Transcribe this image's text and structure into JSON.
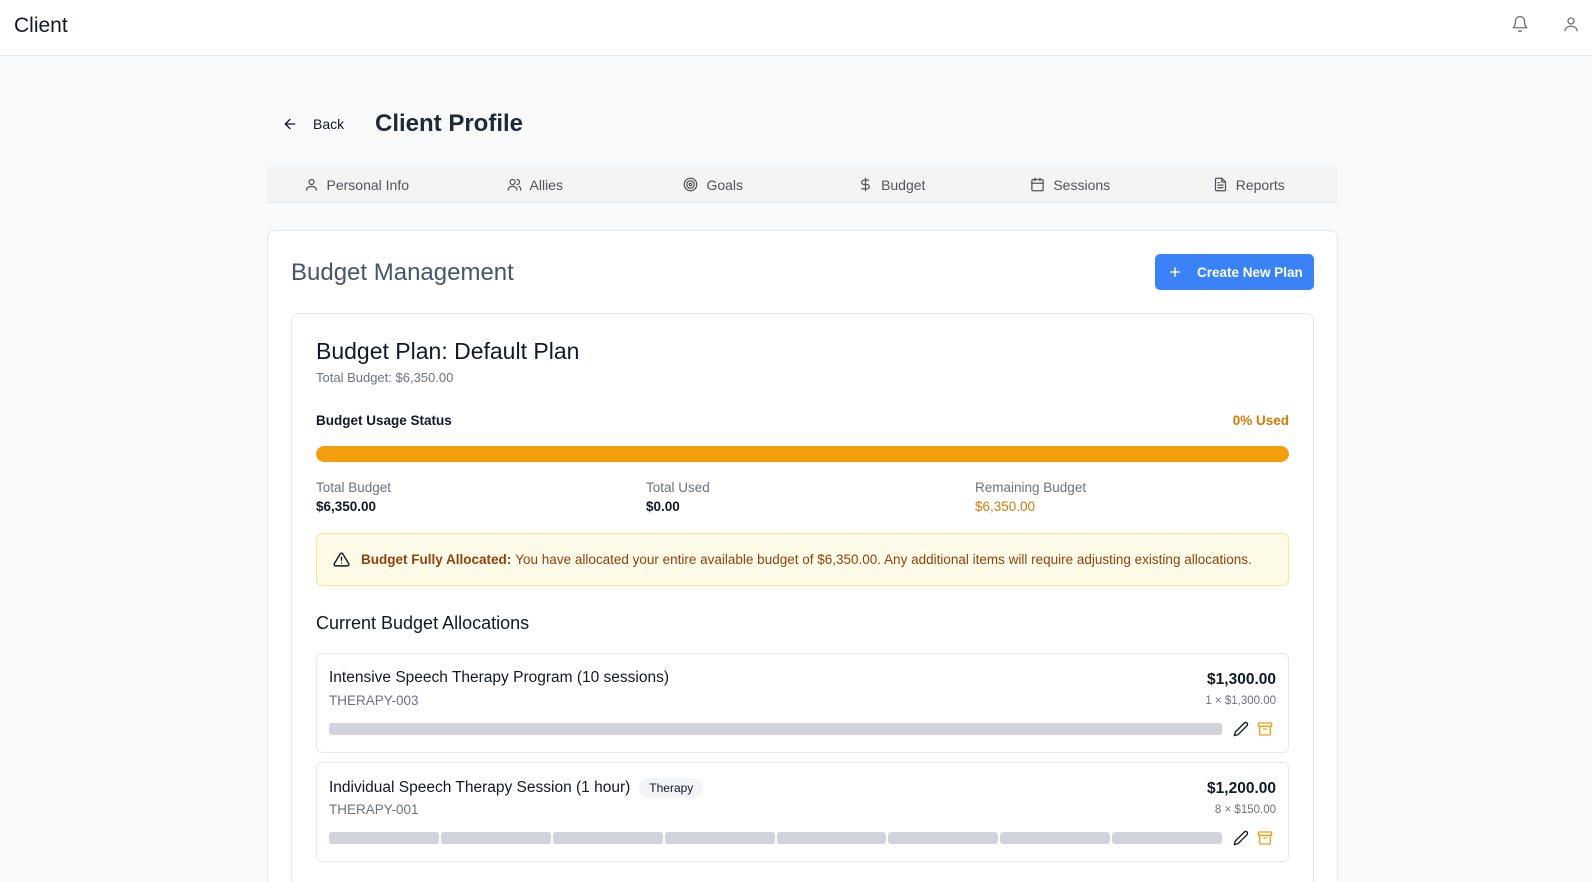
{
  "header": {
    "app_title": "Client"
  },
  "page": {
    "back_label": "Back",
    "title": "Client Profile"
  },
  "tabs": [
    {
      "label": "Personal Info",
      "icon": "user-icon"
    },
    {
      "label": "Allies",
      "icon": "users-icon"
    },
    {
      "label": "Goals",
      "icon": "target-icon"
    },
    {
      "label": "Budget",
      "icon": "dollar-icon"
    },
    {
      "label": "Sessions",
      "icon": "calendar-icon"
    },
    {
      "label": "Reports",
      "icon": "file-icon"
    }
  ],
  "budget": {
    "section_title": "Budget Management",
    "create_label": "Create New Plan",
    "plan_title": "Budget Plan: Default Plan",
    "plan_total": "Total Budget: $6,350.00",
    "usage_label": "Budget Usage Status",
    "usage_pct": "0% Used",
    "usage_fill_fraction": 1.0,
    "stats": [
      {
        "label": "Total Budget",
        "value": "$6,350.00"
      },
      {
        "label": "Total Used",
        "value": "$0.00"
      },
      {
        "label": "Remaining Budget",
        "value": "$6,350.00"
      }
    ],
    "alert": {
      "bold": "Budget Fully Allocated:",
      "text": "You have allocated your entire available budget of $6,350.00. Any additional items will require adjusting existing allocations."
    },
    "allocations_title": "Current Budget Allocations",
    "allocations": [
      {
        "name": "Intensive Speech Therapy Program (10 sessions)",
        "code": "THERAPY-003",
        "amount": "$1,300.00",
        "unit": "1 × $1,300.00",
        "badge": "",
        "segments": 1
      },
      {
        "name": "Individual Speech Therapy Session (1 hour)",
        "code": "THERAPY-001",
        "amount": "$1,200.00",
        "unit": "8 × $150.00",
        "badge": "Therapy",
        "segments": 8
      }
    ]
  },
  "colors": {
    "accent": "#3b82f6",
    "warning": "#f59e0b",
    "warning_text": "#d97706"
  }
}
